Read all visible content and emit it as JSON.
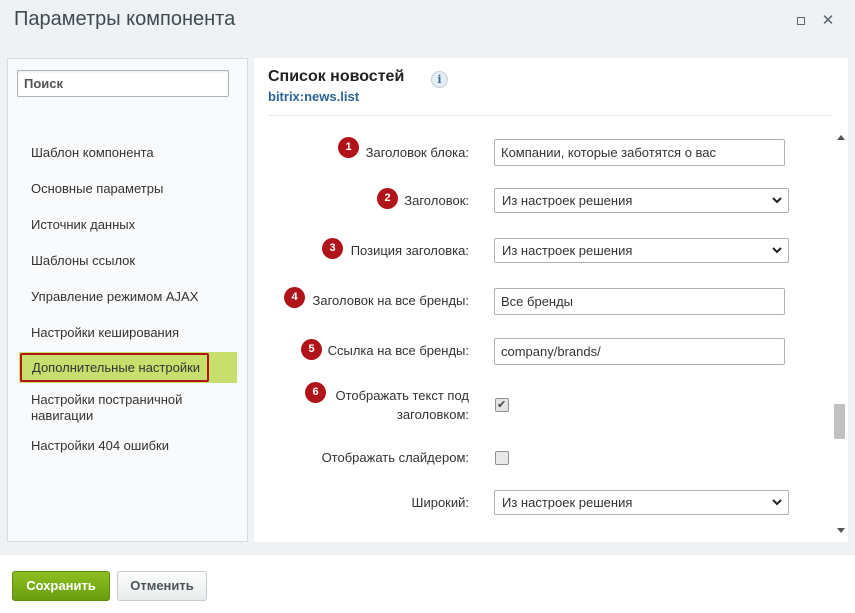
{
  "window": {
    "title": "Параметры компонента",
    "maximize_icon": "maximize-icon",
    "close_icon": "close-icon"
  },
  "sidebar": {
    "search_placeholder": "Поиск",
    "items": [
      {
        "label": "Шаблон компонента",
        "active": false
      },
      {
        "label": "Основные параметры",
        "active": false
      },
      {
        "label": "Источник данных",
        "active": false
      },
      {
        "label": "Шаблоны ссылок",
        "active": false
      },
      {
        "label": "Управление режимом AJAX",
        "active": false
      },
      {
        "label": "Настройки кеширования",
        "active": false
      },
      {
        "label": "Дополнительные настройки",
        "active": true
      },
      {
        "label": "Настройки постраничной навигации",
        "active": false
      },
      {
        "label": "Настройки 404 ошибки",
        "active": false
      }
    ]
  },
  "main": {
    "title": "Список новостей",
    "info_icon": "info-icon",
    "component_code": "bitrix:news.list",
    "fields": [
      {
        "badge": "1",
        "label": "Заголовок блока:",
        "type": "text",
        "value": "Компании, которые заботятся о вас"
      },
      {
        "badge": "2",
        "label": "Заголовок:",
        "type": "select",
        "value": "Из настроек решения"
      },
      {
        "badge": "3",
        "label": "Позиция заголовка:",
        "type": "select",
        "value": "Из настроек решения"
      },
      {
        "badge": "4",
        "label": "Заголовок на все бренды:",
        "type": "text",
        "value": "Все бренды"
      },
      {
        "badge": "5",
        "label": "Ссылка на все бренды:",
        "type": "text",
        "value": "company/brands/"
      },
      {
        "badge": "6",
        "label_line1": "Отображать текст под",
        "label_line2": "заголовком:",
        "type": "checkbox",
        "checked": true
      },
      {
        "label": "Отображать слайдером:",
        "type": "checkbox",
        "checked": false
      },
      {
        "label": "Широкий:",
        "type": "select",
        "value": "Из настроек решения"
      }
    ]
  },
  "footer": {
    "save_label": "Сохранить",
    "cancel_label": "Отменить"
  },
  "colors": {
    "badge": "#b0141a",
    "active_item_bg": "#c8de6d",
    "save_button": "#7aae17",
    "link": "#2a6496"
  }
}
